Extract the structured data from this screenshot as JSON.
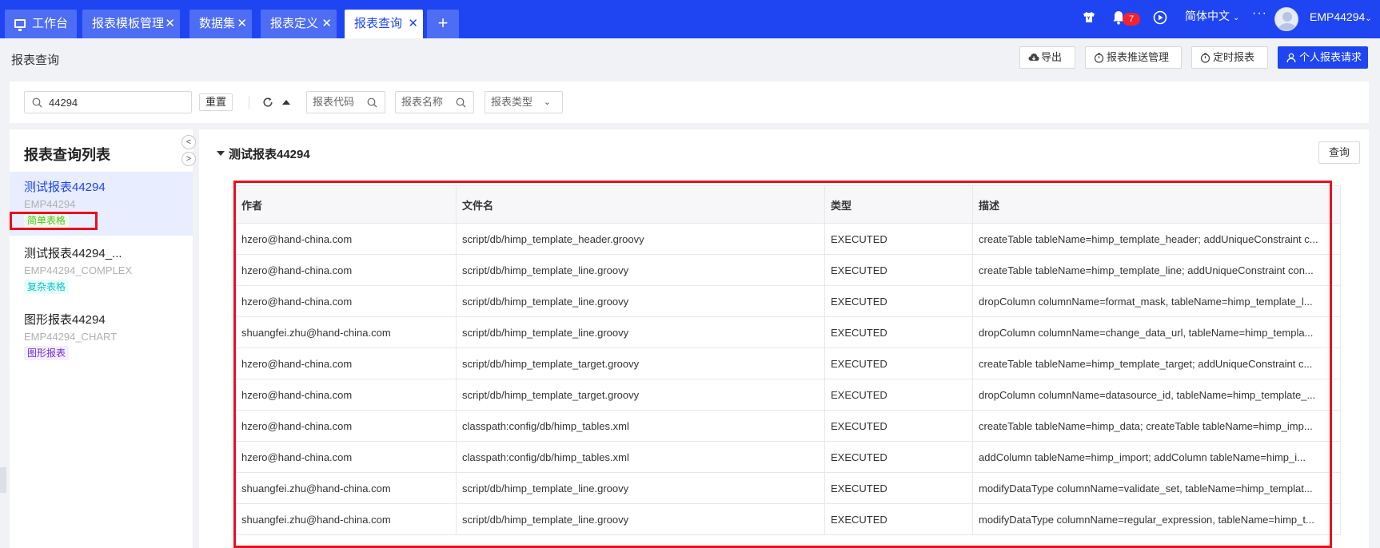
{
  "tabs": [
    {
      "label": "工作台",
      "closable": false,
      "active": false
    },
    {
      "label": "报表模板管理",
      "closable": true,
      "active": false
    },
    {
      "label": "数据集",
      "closable": true,
      "active": false
    },
    {
      "label": "报表定义",
      "closable": true,
      "active": false
    },
    {
      "label": "报表查询",
      "closable": true,
      "active": true
    }
  ],
  "tab_add": "+",
  "header_right": {
    "notification_count": "7",
    "language": "简体中文",
    "more": "···",
    "username": "EMP44294"
  },
  "page": {
    "title": "报表查询",
    "buttons": {
      "export": "导出",
      "push_manage": "报表推送管理",
      "schedule": "定时报表",
      "personal_request": "个人报表请求"
    }
  },
  "filters": {
    "search_value": "44294",
    "reset": "重置",
    "code_placeholder": "报表代码",
    "name_placeholder": "报表名称",
    "type_placeholder": "报表类型"
  },
  "sidebar": {
    "title": "报表查询列表",
    "items": [
      {
        "title": "测试报表44294",
        "code": "EMP44294",
        "tag": "简单表格"
      },
      {
        "title": "测试报表44294_...",
        "code": "EMP44294_COMPLEX",
        "tag": "复杂表格"
      },
      {
        "title": "图形报表44294",
        "code": "EMP44294_CHART",
        "tag": "图形报表"
      }
    ]
  },
  "report": {
    "title": "测试报表44294",
    "query_button": "查询",
    "columns": [
      "作者",
      "文件名",
      "类型",
      "描述"
    ],
    "rows": [
      [
        "hzero@hand-china.com",
        "script/db/himp_template_header.groovy",
        "EXECUTED",
        "createTable tableName=himp_template_header; addUniqueConstraint c..."
      ],
      [
        "hzero@hand-china.com",
        "script/db/himp_template_line.groovy",
        "EXECUTED",
        "createTable tableName=himp_template_line; addUniqueConstraint con..."
      ],
      [
        "hzero@hand-china.com",
        "script/db/himp_template_line.groovy",
        "EXECUTED",
        "dropColumn columnName=format_mask, tableName=himp_template_l..."
      ],
      [
        "shuangfei.zhu@hand-china.com",
        "script/db/himp_template_line.groovy",
        "EXECUTED",
        "dropColumn columnName=change_data_url, tableName=himp_templa..."
      ],
      [
        "hzero@hand-china.com",
        "script/db/himp_template_target.groovy",
        "EXECUTED",
        "createTable tableName=himp_template_target; addUniqueConstraint c..."
      ],
      [
        "hzero@hand-china.com",
        "script/db/himp_template_target.groovy",
        "EXECUTED",
        "dropColumn columnName=datasource_id, tableName=himp_template_..."
      ],
      [
        "hzero@hand-china.com",
        "classpath:config/db/himp_tables.xml",
        "EXECUTED",
        "createTable tableName=himp_data; createTable tableName=himp_imp..."
      ],
      [
        "hzero@hand-china.com",
        "classpath:config/db/himp_tables.xml",
        "EXECUTED",
        "addColumn tableName=himp_import; addColumn tableName=himp_i..."
      ],
      [
        "shuangfei.zhu@hand-china.com",
        "script/db/himp_template_line.groovy",
        "EXECUTED",
        "modifyDataType columnName=validate_set, tableName=himp_templat..."
      ],
      [
        "shuangfei.zhu@hand-china.com",
        "script/db/himp_template_line.groovy",
        "EXECUTED",
        "modifyDataType columnName=regular_expression, tableName=himp_t..."
      ]
    ]
  },
  "colors": {
    "brand": "#1f45f2",
    "highlight_box": "#e8101f",
    "tab_inactive": "#4d6df4"
  }
}
